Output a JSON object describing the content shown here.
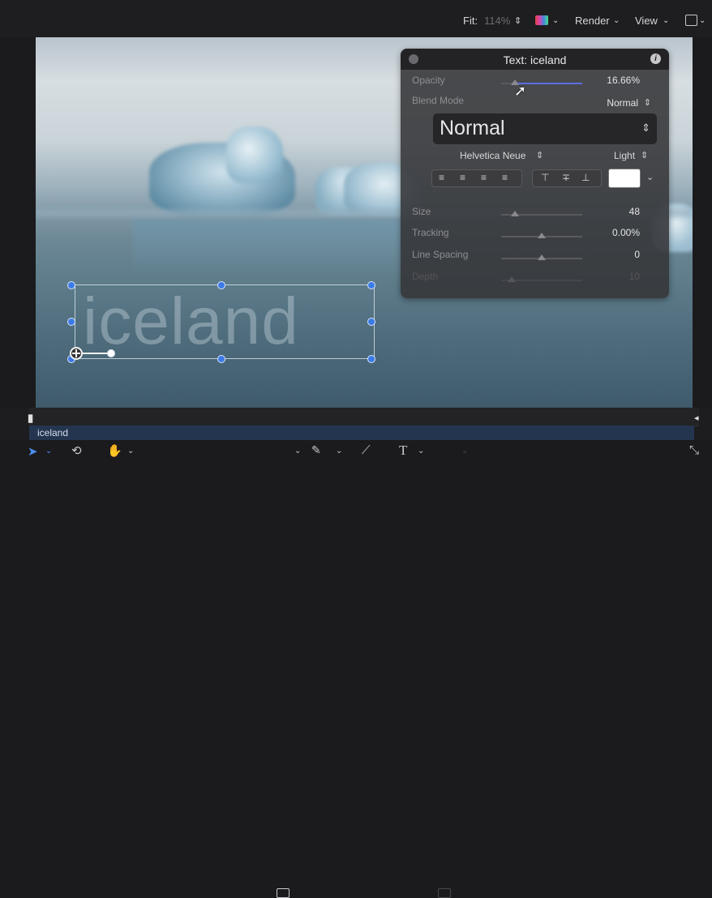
{
  "toolbar": {
    "fit_label": "Fit:",
    "fit_value": "114%",
    "fit_arrow": "⌃⌄",
    "render_label": "Render",
    "view_label": "View"
  },
  "canvas": {
    "text_layer_content": "iceland"
  },
  "hud": {
    "title": "Text: iceland",
    "info_icon": "i",
    "opacity_label": "Opacity",
    "opacity_value": "16.66%",
    "blend_mode_label": "Blend Mode",
    "blend_mode_value": "Normal",
    "font_style_display": "Normal",
    "font_family": "Helvetica Neue",
    "font_weight": "Light",
    "size_label": "Size",
    "size_value": "48",
    "tracking_label": "Tracking",
    "tracking_value": "0.00%",
    "line_spacing_label": "Line Spacing",
    "line_spacing_value": "0",
    "depth_label": "Depth",
    "depth_value": "10",
    "text_color": "#ffffff"
  },
  "timeline": {
    "clip_name": "iceland"
  },
  "colors": {
    "accent_blue": "#3b7be8",
    "opacity_slider": "#5a6ee0"
  }
}
